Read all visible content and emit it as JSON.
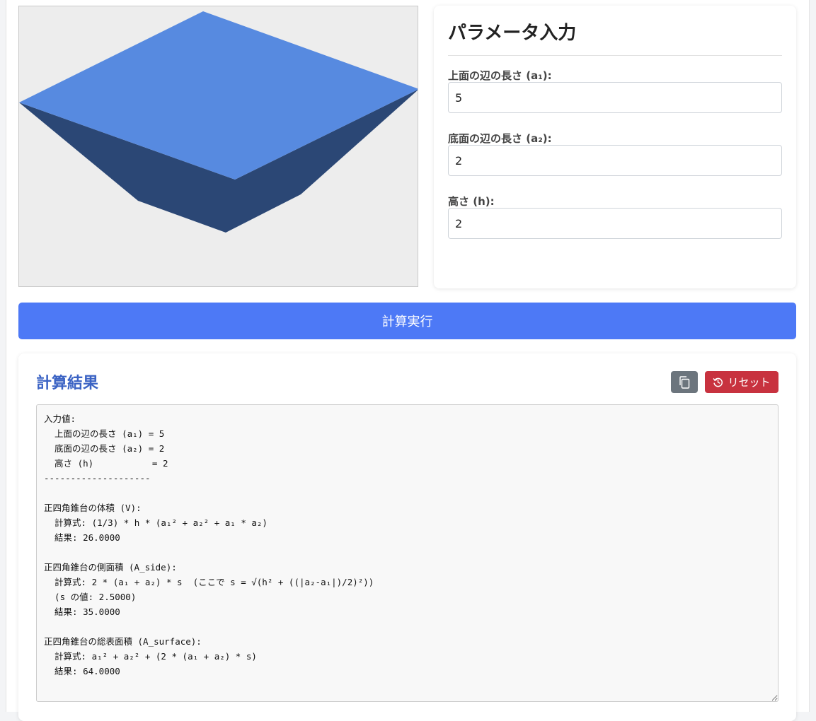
{
  "params": {
    "title": "パラメータ入力",
    "top_edge_label": "上面の辺の長さ (a₁):",
    "top_edge_value": "5",
    "bottom_edge_label": "底面の辺の長さ (a₂):",
    "bottom_edge_value": "2",
    "height_label": "高さ (h):",
    "height_value": "2"
  },
  "actions": {
    "calculate_label": "計算実行"
  },
  "result": {
    "title": "計算結果",
    "copy_icon": "copy-icon",
    "reset_icon": "history-icon",
    "reset_label": "リセット",
    "text": "入力値:\n  上面の辺の長さ (a₁) = 5\n  底面の辺の長さ (a₂) = 2\n  高さ (h)           = 2\n--------------------\n\n正四角錐台の体積 (V):\n  計算式: (1/3) * h * (a₁² + a₂² + a₁ * a₂)\n  結果: 26.0000\n\n正四角錐台の側面積 (A_side):\n  計算式: 2 * (a₁ + a₂) * s  (ここで s = √(h² + ((|a₂-a₁|)/2)²))\n  (s の値: 2.5000)\n  結果: 35.0000\n\n正四角錐台の総表面積 (A_surface):\n  計算式: a₁² + a₂² + (2 * (a₁ + a₂) * s)\n  結果: 64.0000"
  },
  "colors": {
    "top_face": "#578ae0",
    "side_face": "#2b4775",
    "viewer_bg": "#ededed",
    "primary": "#4d79f6",
    "danger": "#c8323f",
    "secondary": "#6c757d",
    "heading_blue": "#3b63c4"
  }
}
